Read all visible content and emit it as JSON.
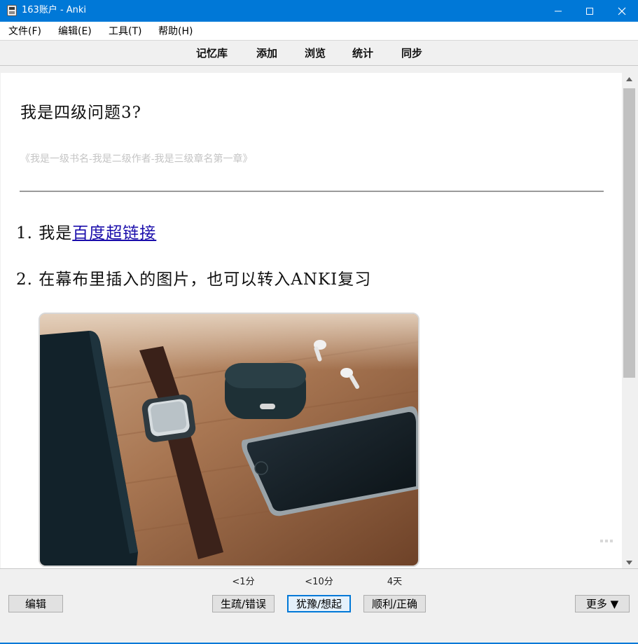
{
  "window": {
    "title": "163账户 - Anki",
    "accent_color": "#0078d7"
  },
  "menu": {
    "items": [
      {
        "label": "文件(F)"
      },
      {
        "label": "编辑(E)"
      },
      {
        "label": "工具(T)"
      },
      {
        "label": "帮助(H)"
      }
    ]
  },
  "toolbar": {
    "links": [
      {
        "label": "记忆库"
      },
      {
        "label": "添加"
      },
      {
        "label": "浏览"
      },
      {
        "label": "统计"
      },
      {
        "label": "同步"
      }
    ]
  },
  "card": {
    "question": "我是四级问题3?",
    "source": "《我是一级书名-我是二级作者-我是三级章名第一章》",
    "answers": {
      "line1_number": "1.",
      "line1_prefix": "我是",
      "line1_link": "百度超链接",
      "line2_number": "2.",
      "line2_text": "在幕布里插入的图片，也可以转入ANKI复习"
    },
    "image_icon": "photo-watch-airpods-phone"
  },
  "bottom": {
    "edit_label": "编辑",
    "more_label": "更多 ▼",
    "answer_buttons": [
      {
        "interval": "<1分",
        "label": "生疏/错误"
      },
      {
        "interval": "<10分",
        "label": "犹豫/想起"
      },
      {
        "interval": "4天",
        "label": "顺利/正确"
      }
    ]
  }
}
